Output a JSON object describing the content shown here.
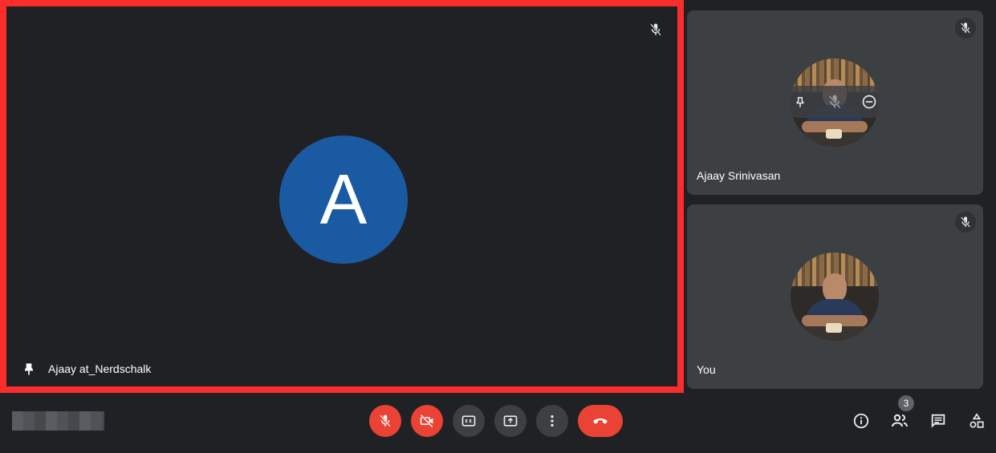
{
  "main_tile": {
    "avatar_letter": "A",
    "participant_name": "Ajaay at_Nerdschalk"
  },
  "side_tiles": [
    {
      "name": "Ajaay Srinivasan",
      "muted": true,
      "hover_actions": [
        "pin-icon",
        "mute-icon",
        "remove-icon"
      ]
    },
    {
      "name": "You",
      "muted": true
    }
  ],
  "controls": {
    "mic": "mic-off-icon",
    "camera": "camera-off-icon",
    "captions": "captions-icon",
    "present": "present-screen-icon",
    "more": "more-vert-icon",
    "leave": "call-end-icon"
  },
  "right_controls": {
    "people_count": "3",
    "icons": [
      "info-icon",
      "people-icon",
      "chat-icon",
      "activities-icon"
    ]
  },
  "colors": {
    "background": "#202124",
    "tile": "#3c4043",
    "highlight_border": "#fb2c2c",
    "avatar": "#1a5aa3",
    "danger": "#ea4335"
  }
}
